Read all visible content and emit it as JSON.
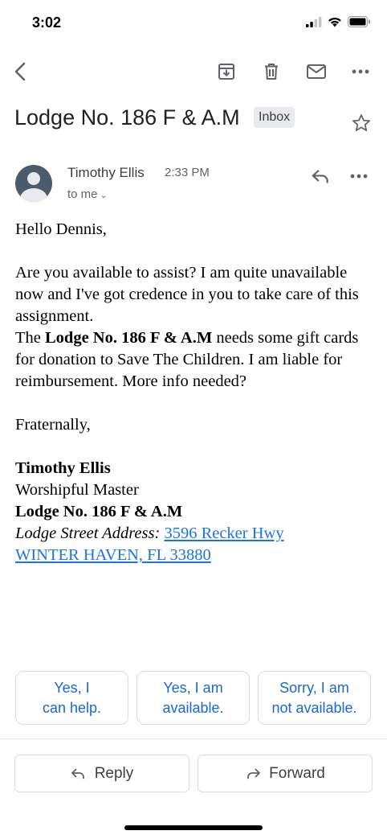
{
  "status": {
    "time": "3:02"
  },
  "toolbar": {
    "back_icon": "back-arrow-icon",
    "archive_icon": "archive-icon",
    "delete_icon": "trash-icon",
    "mark_unread_icon": "mail-icon",
    "more_icon": "more-horizontal-icon"
  },
  "email": {
    "subject": "Lodge No. 186 F & A.M",
    "label": "Inbox",
    "sender": {
      "name": "Timothy Ellis",
      "time": "2:33 PM",
      "to": "to me"
    },
    "body": {
      "greeting": "Hello Dennis,",
      "para1": "Are you available to assist? I am quite unavailable now and I've got credence in you to take care of this assignment.",
      "para2_prefix": "The ",
      "para2_bold": "Lodge No. 186 F & A.M",
      "para2_suffix": " needs some gift cards for donation to Save The Children. I am liable for reimbursement. More info needed?",
      "closing": "Fraternally,",
      "sig_name": "Timothy Ellis",
      "sig_title": "Worshipful Master",
      "sig_lodge": "Lodge No. 186 F & A.M",
      "sig_address_label": "Lodge Street Address:",
      "sig_address_line1": "3596 Recker Hwy",
      "sig_address_line2": "WINTER HAVEN, FL 33880"
    }
  },
  "smart_replies": [
    {
      "line1": "Yes, I",
      "line2": "can help."
    },
    {
      "line1": "Yes, I am",
      "line2": "available."
    },
    {
      "line1": "Sorry, I am",
      "line2": "not available."
    }
  ],
  "actions": {
    "reply": "Reply",
    "forward": "Forward"
  },
  "colors": {
    "link": "#1a73e8",
    "smart_reply": "#1967d2",
    "avatar": "#4a5b6b"
  }
}
